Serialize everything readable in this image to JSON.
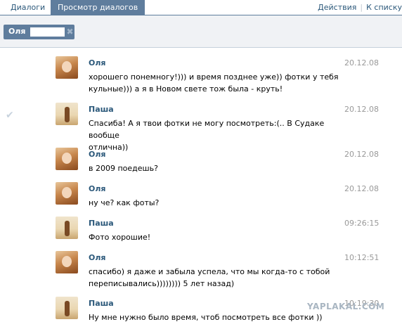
{
  "tabs": [
    {
      "label": "Диалоги"
    },
    {
      "label": "Просмотр диалогов"
    }
  ],
  "actions": {
    "actions_label": "Действия",
    "separator": "|",
    "back_label": "К списку"
  },
  "filter": {
    "chip_name": "Оля",
    "close_glyph": "✖"
  },
  "messages": [
    {
      "author": "Оля",
      "date": "20.12.08",
      "lines": [
        "хорошего понемногу!))) и время позднее уже)) фотки у тебя",
        "кульные))) а я в Новом свете тож была - круть!"
      ]
    },
    {
      "author": "Паша",
      "date": "20.12.08",
      "lines": [
        "Спасиба! А я твои фотки не могу посмотреть:(.. В Судаке вообще",
        "отлична))"
      ],
      "read_mark": "✔"
    },
    {
      "author": "Оля",
      "date": "20.12.08",
      "lines": [
        "в 2009 поедешь?"
      ]
    },
    {
      "author": "Оля",
      "date": "20.12.08",
      "lines": [
        "ну че? как фоты?"
      ]
    },
    {
      "author": "Паша",
      "date": "09:26:15",
      "lines": [
        "Фото хорошие!"
      ]
    },
    {
      "author": "Оля",
      "date": "10:12:51",
      "lines": [
        "спасибо) я даже и забыла успела, что мы когда-то с тобой",
        "переписывались)))))))) 5 лет назад)"
      ]
    },
    {
      "author": "Паша",
      "date": "10:19:30",
      "lines": [
        "Ну мне нужно было время, чтоб посмотреть все фотки ))"
      ]
    }
  ],
  "watermark": "YAPLAKAL.COM"
}
